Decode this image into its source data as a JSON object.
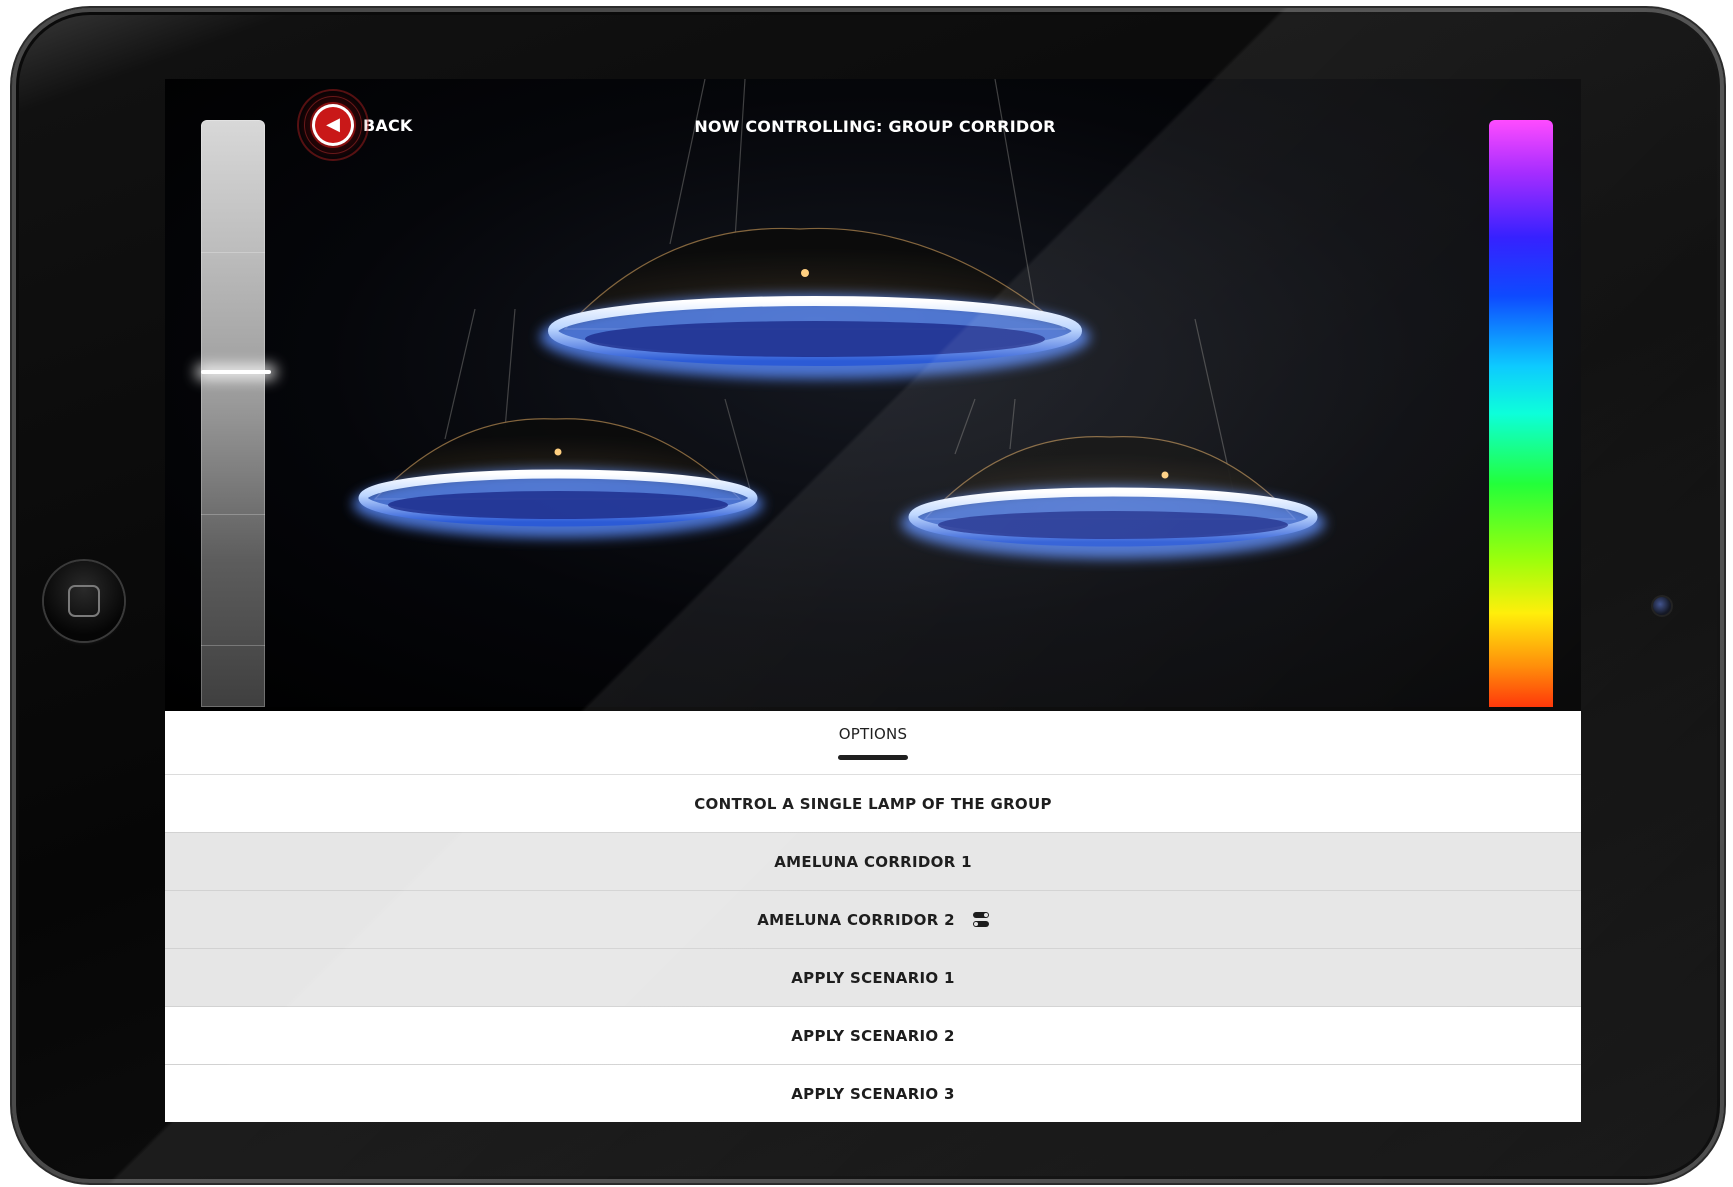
{
  "header": {
    "back_label": "BACK",
    "now_controlling": "NOW CONTROLLING: GROUP CORRIDOR"
  },
  "controls": {
    "dimmer_level": 0.43,
    "hue_spectrum": [
      "#ff40ff",
      "#2a14ff",
      "#00c8ff",
      "#18ff30",
      "#ffee00",
      "#ff3000"
    ]
  },
  "options": {
    "title": "OPTIONS",
    "rows": [
      {
        "label": "CONTROL A SINGLE LAMP OF THE GROUP",
        "style": "white"
      },
      {
        "label": "AMELUNA CORRIDOR 1",
        "style": "grey"
      },
      {
        "label": "AMELUNA CORRIDOR 2",
        "style": "grey",
        "icon": "toggle-icon"
      },
      {
        "label": "APPLY SCENARIO 1",
        "style": "grey"
      },
      {
        "label": "APPLY SCENARIO 2",
        "style": "white"
      },
      {
        "label": "APPLY SCENARIO 3",
        "style": "white"
      }
    ]
  },
  "colors": {
    "back_button": "#c91818",
    "lamp_glow": "#6fa8ff",
    "panel_row_grey": "#e6e6e6",
    "panel_row_white": "#ffffff"
  }
}
